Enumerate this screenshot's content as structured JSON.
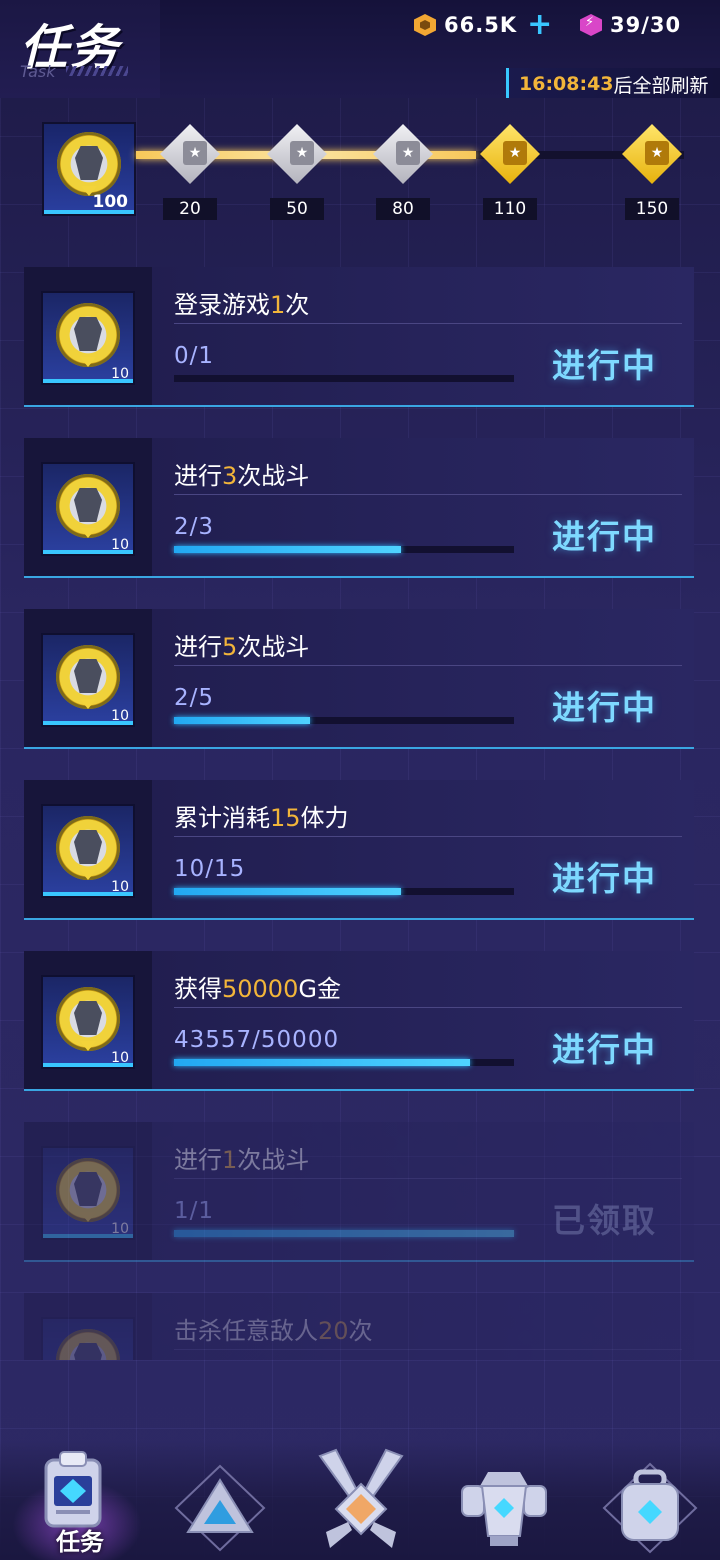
{
  "header": {
    "title": "任务",
    "subtitle": "Task",
    "coins": "66.5K",
    "energy": "39/30",
    "refresh_time": "16:08:43",
    "refresh_text": "后全部刷新",
    "colors": {
      "accent": "#39c6ff",
      "gold": "#f2b53a"
    }
  },
  "progress": {
    "current_points": "100",
    "track_fill_fraction": 0.62,
    "milestones": [
      {
        "label": "20",
        "state": "silver"
      },
      {
        "label": "50",
        "state": "silver"
      },
      {
        "label": "80",
        "state": "silver"
      },
      {
        "label": "110",
        "state": "gold"
      },
      {
        "label": "150",
        "state": "gold"
      }
    ]
  },
  "tasks": [
    {
      "title_pre": "登录游戏",
      "title_hl": "1",
      "title_post": "次",
      "progress": "0/1",
      "fill": 0.0,
      "status": "进行中",
      "reward": "10"
    },
    {
      "title_pre": "进行",
      "title_hl": "3",
      "title_post": "次战斗",
      "progress": "2/3",
      "fill": 0.667,
      "status": "进行中",
      "reward": "10"
    },
    {
      "title_pre": "进行",
      "title_hl": "5",
      "title_post": "次战斗",
      "progress": "2/5",
      "fill": 0.4,
      "status": "进行中",
      "reward": "10"
    },
    {
      "title_pre": "累计消耗",
      "title_hl": "15",
      "title_post": "体力",
      "progress": "10/15",
      "fill": 0.667,
      "status": "进行中",
      "reward": "10"
    },
    {
      "title_pre": "获得",
      "title_hl": "50000",
      "title_post": "G金",
      "progress": "43557/50000",
      "fill": 0.871,
      "status": "进行中",
      "reward": "10"
    },
    {
      "title_pre": "进行",
      "title_hl": "1",
      "title_post": "次战斗",
      "progress": "1/1",
      "fill": 1.0,
      "status": "已领取",
      "reward": "10"
    },
    {
      "title_pre": "击杀任意敌人",
      "title_hl": "20",
      "title_post": "次",
      "progress": "",
      "fill": 0.0,
      "status": "",
      "reward": ""
    }
  ],
  "nav": {
    "items": [
      {
        "name": "任务",
        "icon": "task-clipboard-icon",
        "active": true
      },
      {
        "name": "",
        "icon": "triangle-stage-icon",
        "active": false
      },
      {
        "name": "",
        "icon": "crossed-swords-icon",
        "active": false
      },
      {
        "name": "",
        "icon": "mech-armor-icon",
        "active": false
      },
      {
        "name": "",
        "icon": "backpack-icon",
        "active": false
      }
    ]
  }
}
